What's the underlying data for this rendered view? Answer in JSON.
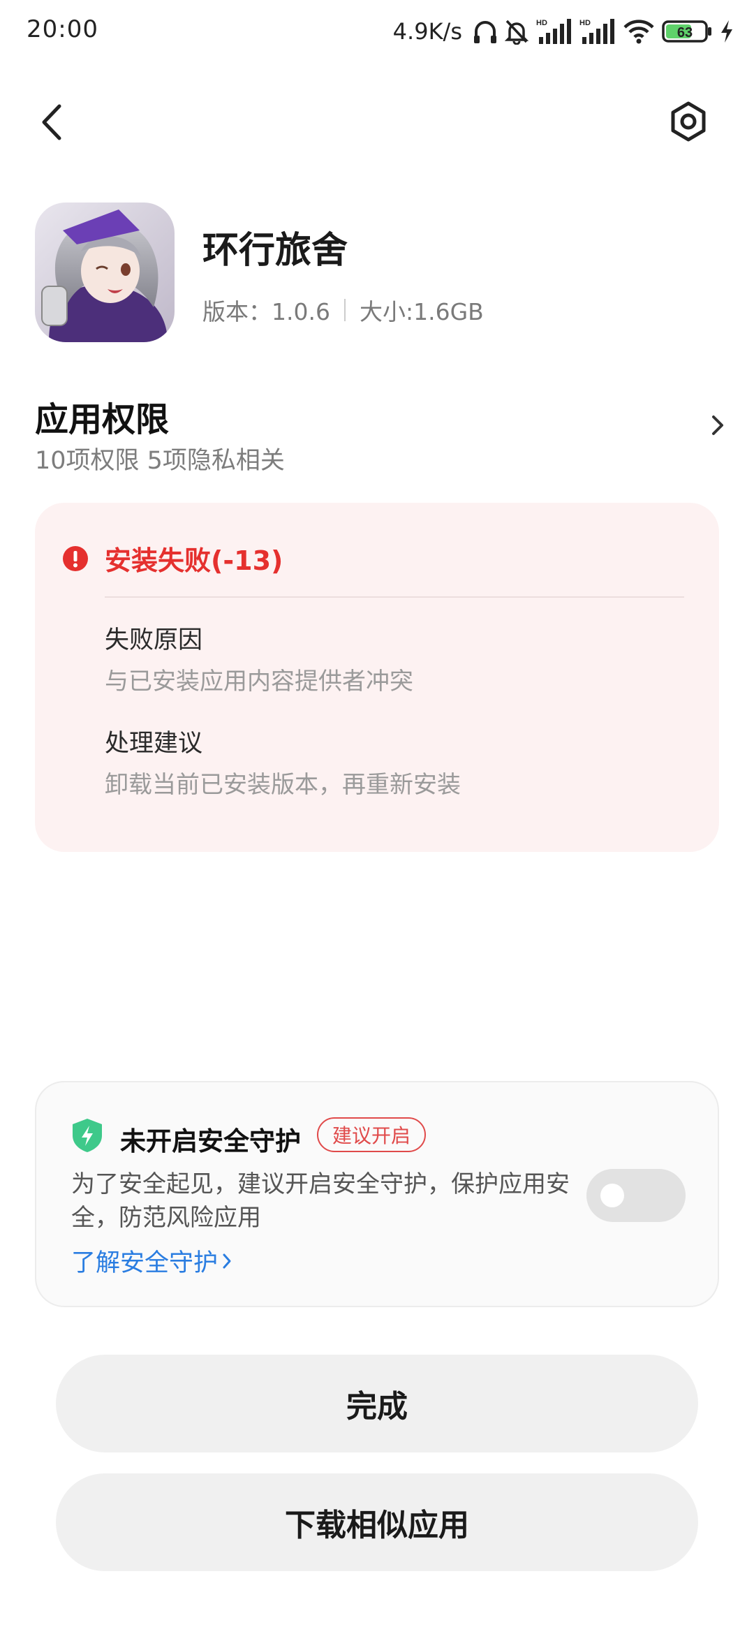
{
  "status_bar": {
    "time": "20:00",
    "net_speed": "4.9K/s",
    "battery_level": "63"
  },
  "header": {
    "back_icon": "back-arrow-icon",
    "settings_icon": "gear-icon"
  },
  "app": {
    "name": "环行旅舍",
    "version": "版本：1.0.6",
    "size": "大小:1.6GB"
  },
  "permissions": {
    "title": "应用权限",
    "subtitle": "10项权限 5项隐私相关"
  },
  "error": {
    "title": "安装失败(-13)",
    "reason_label": "失败原因",
    "reason_value": "与已安装应用内容提供者冲突",
    "advice_label": "处理建议",
    "advice_value": "卸载当前已安装版本，再重新安装",
    "color": "#e5302e"
  },
  "security": {
    "title": "未开启安全守护",
    "badge": "建议开启",
    "description": "为了安全起见，建议开启安全守护，保护应用安全，防范风险应用",
    "link": "了解安全守护",
    "toggle_on": false,
    "link_color": "#2a7de1",
    "shield_color": "#3ec98a"
  },
  "buttons": {
    "done": "完成",
    "download_similar": "下载相似应用"
  }
}
